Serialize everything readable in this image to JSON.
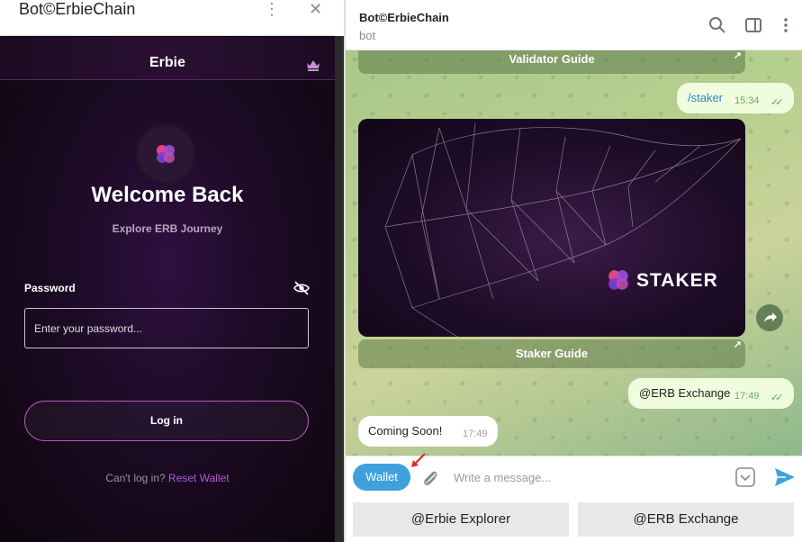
{
  "left_window": {
    "title": "Bot©ErbieChain",
    "menu_icon": "more-vertical-icon",
    "close_icon": "close-icon"
  },
  "app": {
    "title": "Erbie",
    "welcome": "Welcome Back",
    "subtitle": "Explore ERB Journey",
    "password_label": "Password",
    "password_placeholder": "Enter your password...",
    "login_label": "Log in",
    "cant_login": "Can't log in?",
    "reset_link": "Reset Wallet",
    "accent_color": "#b15ccf"
  },
  "chat": {
    "name": "Bot©ErbieChain",
    "status": "bot",
    "messages": {
      "validator_guide": "Validator Guide",
      "staker_cmd": "/staker",
      "staker_time": "15:34",
      "photo_brand": "STAKER",
      "staker_guide": "Staker Guide",
      "erb_exchange": "@ERB Exchange",
      "erb_exchange_time": "17:49",
      "coming_soon": "Coming Soon!",
      "coming_soon_time": "17:49"
    },
    "composer": {
      "wallet_label": "Wallet",
      "placeholder": "Write a message..."
    },
    "reply_keyboard": [
      {
        "label": "@Erbie Explorer"
      },
      {
        "label": "@ERB Exchange"
      }
    ]
  }
}
